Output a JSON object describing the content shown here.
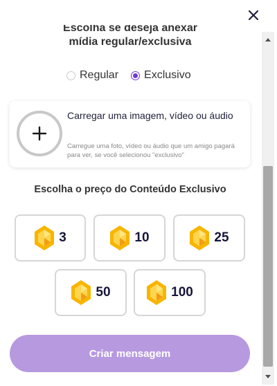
{
  "modal": {
    "header_line1": "Escolha se deseja anexar",
    "header_line2": "mídia regular/exclusiva"
  },
  "media_type": {
    "options": [
      {
        "label": "Regular",
        "selected": false
      },
      {
        "label": "Exclusivo",
        "selected": true
      }
    ]
  },
  "upload": {
    "title": "Carregar uma imagem, vídeo ou áudio",
    "description": "Carregue uma foto, vídeo ou áudio que um amigo pagará para ver, se você selecionou \"exclusivo\""
  },
  "price": {
    "heading": "Escolha o preço do Conteúdo Exclusivo",
    "options": [
      "3",
      "10",
      "25",
      "50",
      "100"
    ]
  },
  "cta": {
    "label": "Criar mensagem"
  },
  "icons": {
    "close": "close-icon",
    "plus": "plus-icon",
    "gem": "gem-icon"
  },
  "colors": {
    "accent": "#6c3bd6",
    "cta_bg": "#b799df",
    "gem_gold": "#f5b400"
  }
}
